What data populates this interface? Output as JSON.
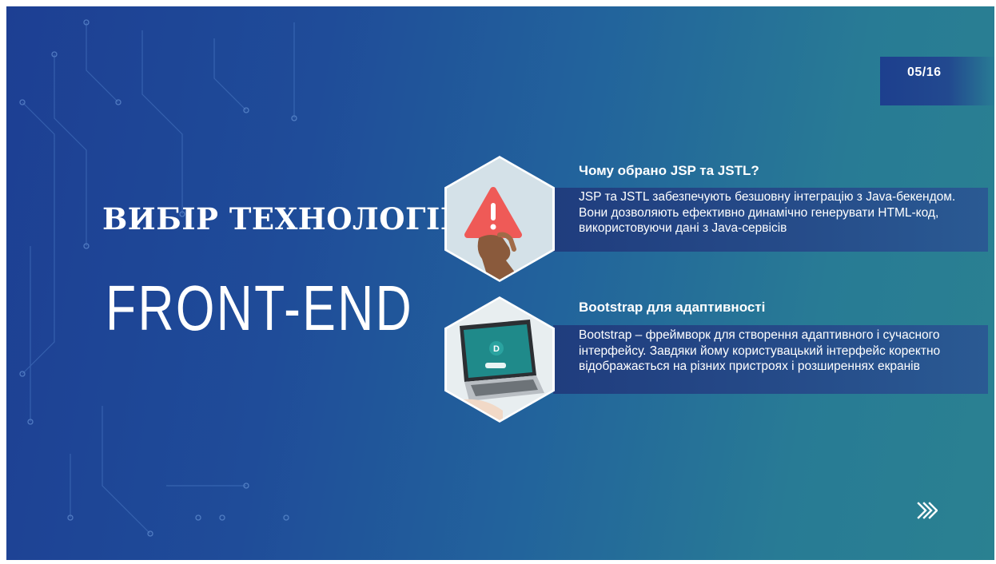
{
  "slide": {
    "page_indicator": "05/16",
    "title_line1": "ВИБІР ТЕХНОЛОГІЙ:",
    "title_line2": "FRONT-END"
  },
  "cards": [
    {
      "title": "Чому обрано JSP та JSTL?",
      "text": "JSP та JSTL забезпечують безшовну інтеграцію з Java-бекендом. Вони дозволяють ефективно динамічно генерувати HTML-код, використовуючи дані з Java-сервісів",
      "image_icon": "warning-hand-image"
    },
    {
      "title": "Bootstrap для адаптивності",
      "text": "Bootstrap – фреймворк для створення адаптивного і сучасного інтерфейсу. Завдяки йому користувацький інтерфейс коректно відображається на різних пристроях і розширеннях екранів",
      "image_icon": "laptop-image"
    }
  ],
  "navigation": {
    "next_icon": "chevrons-right-icon"
  },
  "colors": {
    "background_start": "#1d3f93",
    "background_end": "#2a8191",
    "band": "#254a88",
    "text": "#ffffff"
  }
}
